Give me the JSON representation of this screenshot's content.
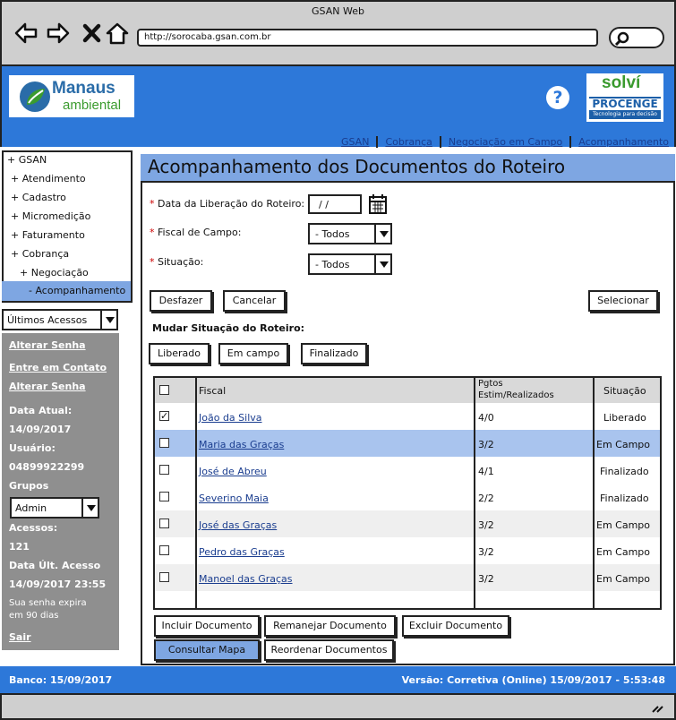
{
  "window": {
    "title": "GSAN Web",
    "url": "http://sorocaba.gsan.com.br"
  },
  "header": {
    "logo_line1": "Manaus",
    "logo_line2": "ambiental",
    "help": "?",
    "partner_logo1": "solví",
    "partner_logo2": "PROCENGE",
    "partner_tagline": "Tecnologia para decisão"
  },
  "breadcrumb": [
    "GSAN",
    "Cobrança",
    "Negociação em Campo",
    "Acompanhamento"
  ],
  "menu": {
    "items": [
      "+ GSAN",
      "+ Atendimento",
      "+ Cadastro",
      "+ Micromedição",
      "+ Faturamento",
      "+ Cobrança",
      "+ Negociação",
      "- Acompanhamento"
    ]
  },
  "recent": {
    "selected": "Últimos Acessos"
  },
  "info": {
    "link_change_password": "Alterar Senha",
    "link_contact": "Entre em Contato",
    "link_change_password2": "Alterar Senha",
    "date_label": "Data Atual:",
    "date_value": "14/09/2017",
    "user_label": "Usuário:",
    "user_value": "04899922299",
    "groups_label": "Grupos",
    "group_selected": "Admin",
    "access_label": "Acessos:",
    "access_value": "121",
    "last_access_label": "Data Últ. Acesso",
    "last_access_value": "14/09/2017 23:55",
    "expire_line1": "Sua senha expira",
    "expire_line2": "em 90 dias",
    "logout": "Sair"
  },
  "page": {
    "title": "Acompanhamento dos Documentos do Roteiro"
  },
  "form": {
    "req": "*",
    "release_date_label": "Data da Liberação do Roteiro:",
    "release_date_value": "/ /",
    "fiscal_label": "Fiscal de Campo:",
    "fiscal_value": "- Todos",
    "status_label": "Situação:",
    "status_value": "- Todos"
  },
  "actions": {
    "undo": "Desfazer",
    "cancel": "Cancelar",
    "select": "Selecionar"
  },
  "change_status": {
    "title": "Mudar Situação do Roteiro:",
    "released": "Liberado",
    "in_field": "Em campo",
    "finished": "Finalizado"
  },
  "table": {
    "headers": {
      "fiscal": "Fiscal",
      "payments1": "Pgtos",
      "payments2": "Estim/Realizados",
      "status": "Situação"
    },
    "rows": [
      {
        "checked": "✓",
        "fiscal": "João da Silva",
        "payments": "4/0",
        "status": "Liberado"
      },
      {
        "checked": "",
        "fiscal": "Maria das Graças",
        "payments": "3/2",
        "status": "Em Campo"
      },
      {
        "checked": "",
        "fiscal": "José de Abreu",
        "payments": "4/1",
        "status": "Finalizado"
      },
      {
        "checked": "",
        "fiscal": "Severino Maia",
        "payments": "2/2",
        "status": "Finalizado"
      },
      {
        "checked": "",
        "fiscal": "José das Graças",
        "payments": "3/2",
        "status": "Em Campo"
      },
      {
        "checked": "",
        "fiscal": "Pedro das Graças",
        "payments": "3/2",
        "status": "Em Campo"
      },
      {
        "checked": "",
        "fiscal": "Manoel das Graças",
        "payments": "3/2",
        "status": "Em Campo"
      }
    ]
  },
  "doc_actions": {
    "include": "Incluir Documento",
    "reassign": "Remanejar Documento",
    "delete": "Excluir Documento",
    "map": "Consultar Mapa",
    "reorder": "Reordenar Documentos"
  },
  "footer": {
    "bank": "Banco: 15/09/2017",
    "version": "Versão: Corretiva (Online) 15/09/2017 - 5:53:48"
  },
  "colors": {
    "header_blue": "#2d78d9",
    "highlight": "#7ea6e2",
    "panel_grey": "#8f8f8f"
  }
}
